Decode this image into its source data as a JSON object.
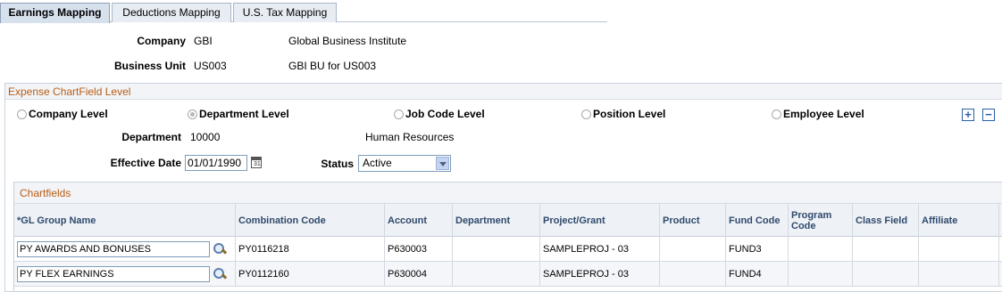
{
  "tabs": [
    {
      "label": "Earnings Mapping",
      "active": true
    },
    {
      "label": "Deductions Mapping",
      "active": false
    },
    {
      "label": "U.S. Tax Mapping",
      "active": false
    }
  ],
  "header": {
    "company_label": "Company",
    "company_code": "GBI",
    "company_name": "Global Business Institute",
    "bu_label": "Business Unit",
    "bu_code": "US003",
    "bu_name": "GBI BU for US003"
  },
  "expense": {
    "title": "Expense ChartField Level",
    "levels": [
      {
        "label": "Company Level",
        "selected": false
      },
      {
        "label": "Department Level",
        "selected": true
      },
      {
        "label": "Job Code Level",
        "selected": false
      },
      {
        "label": "Position Level",
        "selected": false
      },
      {
        "label": "Employee Level",
        "selected": false
      }
    ],
    "add_icon": "plus-icon",
    "remove_icon": "minus-icon",
    "department_label": "Department",
    "department_code": "10000",
    "department_name": "Human Resources",
    "effdt_label": "Effective Date",
    "effdt_value": "01/01/1990",
    "status_label": "Status",
    "status_value": "Active"
  },
  "chartfields": {
    "title": "Chartfields",
    "columns": [
      "*GL Group Name",
      "Combination Code",
      "Account",
      "Department",
      "Project/Grant",
      "Product",
      "Fund Code",
      "Program Code",
      "Class Field",
      "Affiliate"
    ],
    "rows": [
      {
        "gl_group": "PY AWARDS AND BONUSES",
        "combo": "PY0116218",
        "account": "P630003",
        "department": "",
        "project": "SAMPLEPROJ - 03",
        "product": "",
        "fund": "FUND3",
        "program": "",
        "class": "",
        "affiliate": ""
      },
      {
        "gl_group": "PY FLEX EARNINGS",
        "combo": "PY0112160",
        "account": "P630004",
        "department": "",
        "project": "SAMPLEPROJ - 03",
        "product": "",
        "fund": "FUND4",
        "program": "",
        "class": "",
        "affiliate": ""
      }
    ]
  },
  "colors": {
    "accent_title": "#b85c14",
    "header_text": "#2f4a6d",
    "tab_bg": "#e8edf4"
  }
}
